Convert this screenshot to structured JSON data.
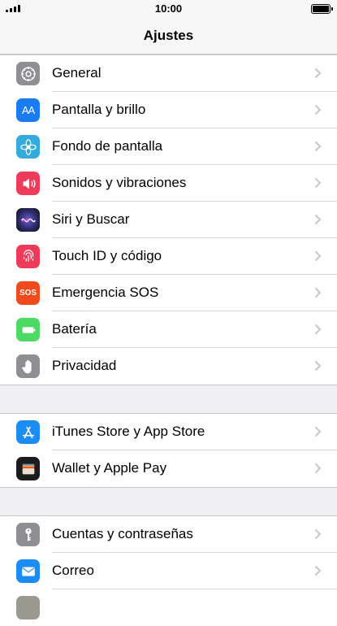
{
  "status": {
    "time": "10:00"
  },
  "nav": {
    "title": "Ajustes"
  },
  "groups": [
    {
      "items": [
        {
          "label": "General",
          "icon": "gear-icon",
          "color": "#8e8e93"
        },
        {
          "label": "Pantalla y brillo",
          "icon": "display-brightness-icon",
          "color": "#1a7cf4"
        },
        {
          "label": "Fondo de pantalla",
          "icon": "wallpaper-flower-icon",
          "color": "#35aadc"
        },
        {
          "label": "Sonidos y vibraciones",
          "icon": "speaker-icon",
          "color": "#ee3b59"
        },
        {
          "label": "Siri y Buscar",
          "icon": "siri-icon",
          "color": "#2a2a6a"
        },
        {
          "label": "Touch ID y código",
          "icon": "fingerprint-icon",
          "color": "#ee3b59"
        },
        {
          "label": "Emergencia SOS",
          "icon": "sos-icon",
          "color": "#f04a1d"
        },
        {
          "label": "Batería",
          "icon": "battery-icon",
          "color": "#4cd964"
        },
        {
          "label": "Privacidad",
          "icon": "hand-icon",
          "color": "#8e8e93"
        }
      ]
    },
    {
      "items": [
        {
          "label": "iTunes Store y App Store",
          "icon": "app-store-icon",
          "color": "#1a8cf4"
        },
        {
          "label": "Wallet y Apple Pay",
          "icon": "wallet-icon",
          "color": "#1c1c1e"
        }
      ]
    },
    {
      "items": [
        {
          "label": "Cuentas y contraseñas",
          "icon": "key-icon",
          "color": "#8e8e93"
        },
        {
          "label": "Correo",
          "icon": "mail-icon",
          "color": "#1a8cf4"
        },
        {
          "label": "",
          "icon": "contacts-icon",
          "color": "#9a9a90"
        }
      ]
    }
  ],
  "icon_text": {
    "display": "AA",
    "sos": "SOS"
  }
}
